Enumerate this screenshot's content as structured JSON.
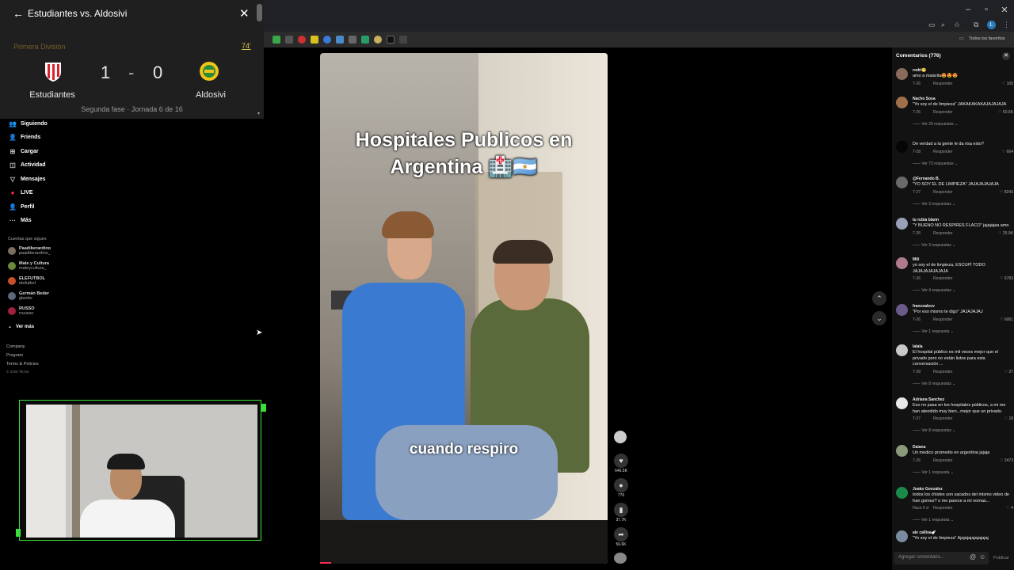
{
  "browser": {
    "favorites_label": "Todos los favoritos",
    "avatar_letter": "L",
    "win_minimize": "–",
    "win_restore": "▫",
    "win_close": "✕"
  },
  "score_panel": {
    "title": "Estudiantes vs. Aldosivi",
    "league": "Primera División",
    "minute": "74'",
    "home_team": "Estudiantes",
    "away_team": "Aldosivi",
    "home_score": "1",
    "separator": "-",
    "away_score": "0",
    "phase": "Segunda fase · Jornada 6 de 16",
    "home_color": "#d8232a",
    "away_color": "#f2c318"
  },
  "sidebar": {
    "nav": [
      {
        "icon": "👥",
        "label": "Siguiendo"
      },
      {
        "icon": "👤",
        "label": "Friends"
      },
      {
        "icon": "⊞",
        "label": "Cargar"
      },
      {
        "icon": "◫",
        "label": "Actividad"
      },
      {
        "icon": "▽",
        "label": "Mensajes"
      },
      {
        "icon": "●",
        "label": "LIVE"
      },
      {
        "icon": "👤",
        "label": "Perfil"
      },
      {
        "icon": "···",
        "label": "Más"
      }
    ],
    "following_header": "Cuentas que sigues",
    "accounts": [
      {
        "name": "Paadiberardino",
        "handle": "paadiberardino_",
        "color": "#7a6e5e"
      },
      {
        "name": "Mate y Cultura",
        "handle": "mateycultura_",
        "color": "#6a8a3a"
      },
      {
        "name": "ELEFUTBOL",
        "handle": "elefutbol",
        "color": "#c8502a"
      },
      {
        "name": "Germán Beder",
        "handle": "gbeder",
        "color": "#5a6a7a"
      },
      {
        "name": "RUSSO",
        "handle": "rruusso",
        "color": "#a02040"
      }
    ],
    "see_more": "Ver más",
    "footer": [
      "Company",
      "Program",
      "Terms & Policies",
      "© 2025 TikTok"
    ]
  },
  "video": {
    "title_line1": "Hospitales Publicos en",
    "title_line2": "Argentina 🏥🇦🇷",
    "subtitle": "cuando respiro",
    "likes": "646.5K",
    "comments": "776",
    "saves": "37.7K",
    "shares": "56.6K"
  },
  "comments_panel": {
    "header": "Comentarios (776)",
    "input_placeholder": "Agregar comentario...",
    "post_label": "Publicar",
    "reply_label": "Responder",
    "items": [
      {
        "user": "rodri😁",
        "text": "amo a maiarita😍😍😍",
        "date": "7-26",
        "likes": "100",
        "more": "",
        "color": "#8a6a5a"
      },
      {
        "user": "Nacho Sosa",
        "text": "\"Yo soy el de limpieza\" JAKAKAKAKAJAJAJAJA",
        "date": "7-26",
        "likes": "50.6K",
        "more": "Ver 29 respuestas",
        "color": "#a0704a"
      },
      {
        "user": "",
        "text": "De verdad a la gente le da risa esto?",
        "date": "7-28",
        "likes": "664",
        "more": "Ver 73 respuestas",
        "color": "#050505"
      },
      {
        "user": "@Fernando B.",
        "text": "\"YO SOY EL DE LIMPIEZA\" JAJAJAJAJAJA",
        "date": "7-27",
        "likes": "8243",
        "more": "Ver 3 respuestas",
        "color": "#6a6a6a"
      },
      {
        "user": "tu rubia biann",
        "text": "\"Y BUENO NO RESPIRES FLACO\" jajajajaa amo",
        "date": "7-26",
        "likes": "25.9K",
        "more": "Ver 3 respuestas",
        "color": "#9aa0b8"
      },
      {
        "user": "Mili",
        "text": "yo soy el de limpieza, ESCUPÍ TODO JAJAJAJAJAJAJA",
        "date": "7-26",
        "likes": "6783",
        "more": "Ver 4 respuestas",
        "color": "#b07a8a"
      },
      {
        "user": "francoalecv",
        "text": "\"Por eso mismo te digo\" JAJAJAJAJ",
        "date": "7-26",
        "likes": "6061",
        "more": "Ver 1 respuesta",
        "color": "#6a5a8a"
      },
      {
        "user": "lalala",
        "text": "El hospital público es mil veces mejor que el privado pero no están listos para esta conversación ...",
        "date": "7-28",
        "likes": "27",
        "more": "Ver 8 respuestas",
        "color": "#c8c8c8"
      },
      {
        "user": "Adriana Sanchez",
        "text": "Eso no pasa en los hospitales públicos, a mi me han atendido muy bien...mejor que un privado.",
        "date": "7-27",
        "likes": "18",
        "more": "Ver 8 respuestas",
        "color": "#e8e8e8"
      },
      {
        "user": "Daiana",
        "text": "Un medico promedio en argentina jajaja",
        "date": "7-26",
        "likes": "2473",
        "more": "Ver 1 respuesta",
        "color": "#8a9a7a"
      },
      {
        "user": "Joako Gonzalez",
        "text": "todos los chistes son sacados del mismo video de fran gomez? o me parece a mi nomas...",
        "date": "Hace 5 d",
        "likes": "4",
        "more": "Ver 1 respuesta",
        "color": "#1a8a4a"
      },
      {
        "user": "ale callisa🍼",
        "text": "\"Yo soy el de limpieza\" Ajajajajajajajajaj",
        "date": "",
        "likes": "",
        "more": "",
        "color": "#7a8aa0"
      }
    ]
  }
}
